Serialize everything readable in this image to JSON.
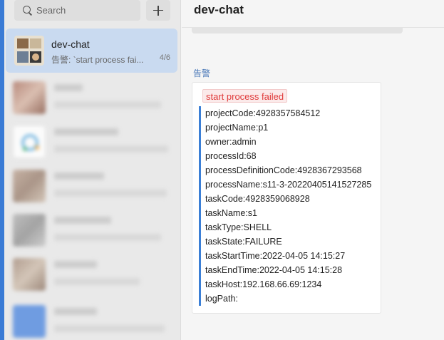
{
  "search": {
    "placeholder": "Search"
  },
  "active_chat": {
    "name": "dev-chat",
    "preview": "告警: `start process fai...",
    "count": "4/6"
  },
  "main": {
    "title": "dev-chat",
    "sender": "告警",
    "alert_tag": "start process failed",
    "lines": [
      "projectCode:4928357584512",
      "projectName:p1",
      "owner:admin",
      "processId:68",
      "processDefinitionCode:4928367293568",
      "processName:s11-3-20220405141527285",
      "taskCode:4928359068928",
      "taskName:s1",
      "taskType:SHELL",
      "taskState:FAILURE",
      "taskStartTime:2022-04-05 14:15:27",
      "taskEndTime:2022-04-05 14:15:28",
      "taskHost:192.168.66.69:1234",
      "logPath:"
    ]
  },
  "colors": {
    "accent": "#3b7fd6",
    "active_bg": "#c9daf0",
    "alert_red": "#e03a3a"
  },
  "icons": {
    "search": "search-icon",
    "add": "plus-icon"
  }
}
